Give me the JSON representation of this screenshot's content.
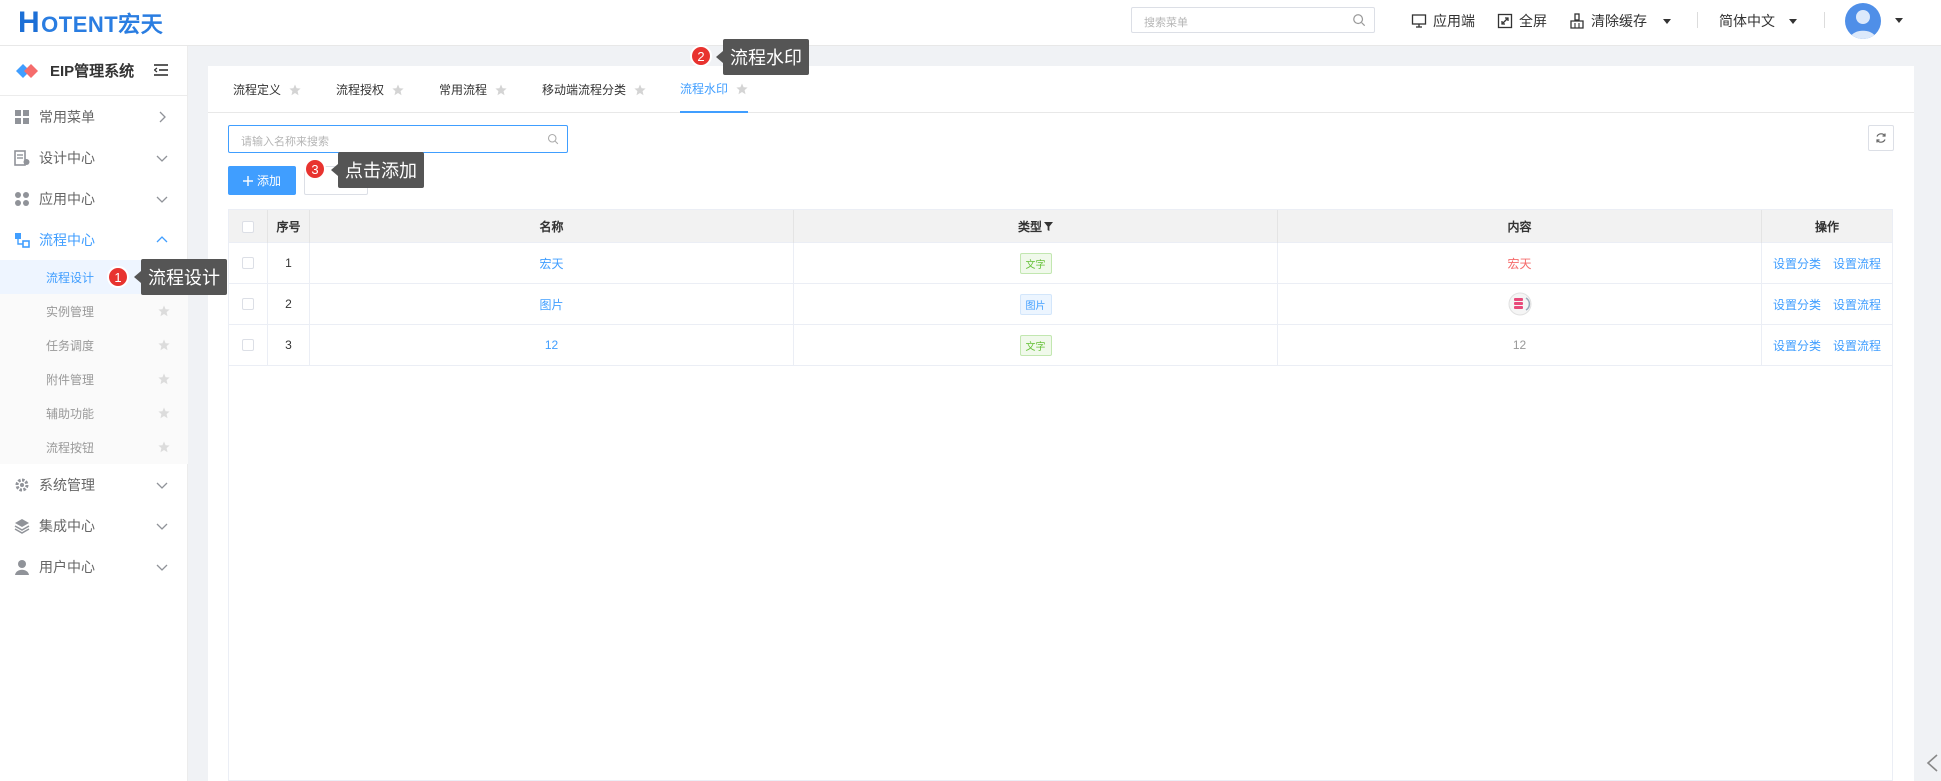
{
  "header": {
    "logo_h": "H",
    "logo_rest": "OTENT宏天",
    "search_placeholder": "搜索菜单",
    "actions": {
      "client": "应用端",
      "fullscreen": "全屏",
      "clear_cache": "清除缓存",
      "language": "简体中文"
    }
  },
  "sidebar": {
    "title": "EIP管理系统",
    "menu": {
      "common": "常用菜单",
      "design": "设计中心",
      "app": "应用中心",
      "flow": "流程中心",
      "system": "系统管理",
      "integration": "集成中心",
      "user": "用户中心"
    },
    "flow_sub": {
      "design": "流程设计",
      "instance": "实例管理",
      "task": "任务调度",
      "attachment": "附件管理",
      "aux": "辅助功能",
      "button": "流程按钮"
    }
  },
  "tabs": {
    "def": "流程定义",
    "auth": "流程授权",
    "common": "常用流程",
    "mobile": "移动端流程分类",
    "watermark": "流程水印"
  },
  "toolbar": {
    "search_placeholder": "请输入名称来搜索",
    "add_label": "添加"
  },
  "table": {
    "headers": {
      "index": "序号",
      "name": "名称",
      "type": "类型",
      "content": "内容",
      "ops": "操作"
    },
    "rows": [
      {
        "index": "1",
        "name": "宏天",
        "type": "文字",
        "content": "宏天"
      },
      {
        "index": "2",
        "name": "图片",
        "type": "图片",
        "content": ""
      },
      {
        "index": "3",
        "name": "12",
        "type": "文字",
        "content": "12"
      }
    ],
    "op_set_category": "设置分类",
    "op_set_flow": "设置流程"
  },
  "annotations": {
    "badge1": "1",
    "tip1": "流程设计",
    "badge2": "2",
    "tip2": "流程水印",
    "badge3": "3",
    "tip3": "点击添加"
  },
  "colors": {
    "accent": "#409eff",
    "badge_red": "#e8332f",
    "tip_bg": "#555555",
    "content_red": "#f56c6c"
  }
}
